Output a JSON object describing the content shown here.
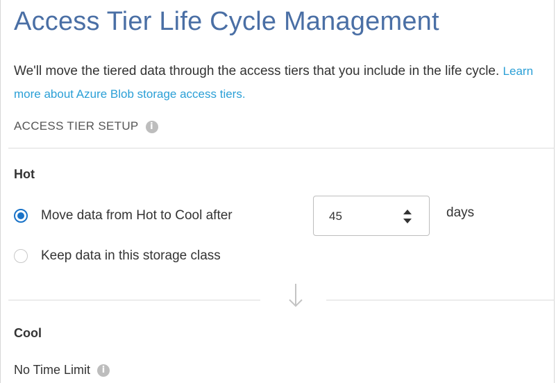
{
  "header": {
    "title": "Access Tier Life Cycle Management"
  },
  "intro": {
    "text": "We'll move the tiered data through the access tiers that you include in the life cycle.",
    "link": "Learn more about Azure Blob storage access tiers."
  },
  "setup": {
    "label": "ACCESS TIER SETUP",
    "info_icon": "info-icon"
  },
  "hot": {
    "name": "Hot",
    "options": [
      {
        "label": "Move data from Hot to Cool after",
        "selected": true
      },
      {
        "label": "Keep data in this storage class",
        "selected": false
      }
    ],
    "days_value": "45",
    "days_label": "days"
  },
  "flow_icon": "arrow-down-icon",
  "cool": {
    "name": "Cool",
    "limit_label": "No Time Limit",
    "info_icon": "info-icon"
  },
  "colors": {
    "title": "#4a6fa5",
    "link": "#2a9fd6",
    "radio_selected": "#1a73c8",
    "info_icon": "#bdbdbd"
  }
}
